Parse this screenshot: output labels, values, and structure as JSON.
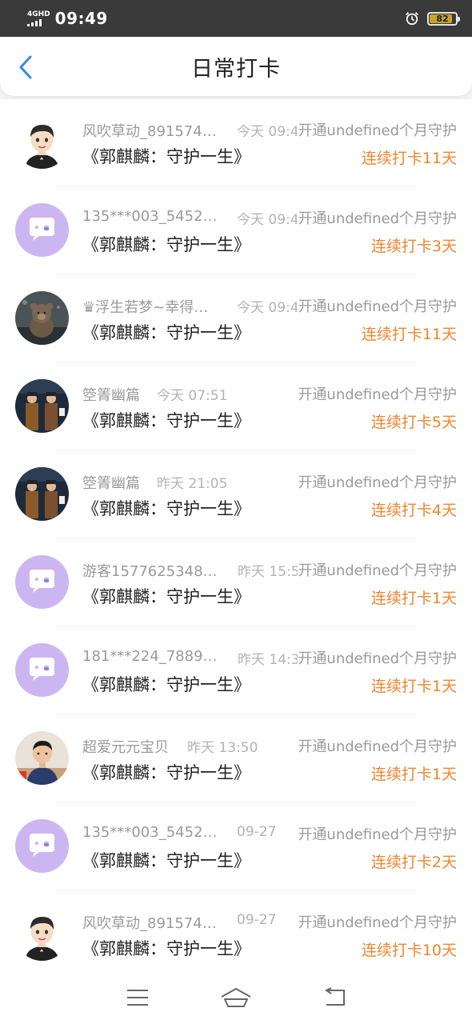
{
  "status_bar": {
    "network": "4GHD",
    "time": "09:49",
    "battery": "82",
    "icons": [
      "signal-icon",
      "alarm-icon",
      "battery-icon"
    ]
  },
  "header": {
    "back_icon": "chevron-left-icon",
    "title": "日常打卡"
  },
  "colors": {
    "accent_blue": "#2f8bf0",
    "streak_orange": "#f0852d",
    "avatar_purple": "#cbb6f2",
    "muted_text": "#9a9a9a"
  },
  "entries": [
    {
      "name": "风吹草动_891574…",
      "time": "今天 09:4…",
      "action": "开通undefined个月守护",
      "book": "《郭麒麟：守护一生》",
      "streak": "连续打卡11天",
      "avatar": "cartoon-boy-avatar"
    },
    {
      "name": "135***003_5452…",
      "time": "今天 09:4…",
      "action": "开通undefined个月守护",
      "book": "《郭麒麟：守护一生》",
      "streak": "连续打卡3天",
      "avatar": "default-chat-avatar"
    },
    {
      "name": "♛浮生若梦~幸得…",
      "time": "今天 09:4…",
      "action": "开通undefined个月守护",
      "book": "《郭麒麟：守护一生》",
      "streak": "连续打卡11天",
      "avatar": "teddy-bear-photo-avatar"
    },
    {
      "name": "箜箐幽篇",
      "time": "今天 07:51",
      "action": "开通undefined个月守护",
      "book": "《郭麒麟：守护一生》",
      "streak": "连续打卡5天",
      "avatar": "two-performers-photo-avatar"
    },
    {
      "name": "箜箐幽篇",
      "time": "昨天 21:05",
      "action": "开通undefined个月守护",
      "book": "《郭麒麟：守护一生》",
      "streak": "连续打卡4天",
      "avatar": "two-performers-photo-avatar"
    },
    {
      "name": "游客1577625348…",
      "time": "昨天 15:5…",
      "action": "开通undefined个月守护",
      "book": "《郭麒麟：守护一生》",
      "streak": "连续打卡1天",
      "avatar": "default-chat-avatar"
    },
    {
      "name": "181***224_7889…",
      "time": "昨天 14:3…",
      "action": "开通undefined个月守护",
      "book": "《郭麒麟：守护一生》",
      "streak": "连续打卡1天",
      "avatar": "default-chat-avatar"
    },
    {
      "name": "超爱元元宝贝",
      "time": "昨天 13:50",
      "action": "开通undefined个月守护",
      "book": "《郭麒麟：守护一生》",
      "streak": "连续打卡1天",
      "avatar": "child-photo-avatar"
    },
    {
      "name": "135***003_5452…",
      "time": "09-27",
      "action": "开通undefined个月守护",
      "book": "《郭麒麟：守护一生》",
      "streak": "连续打卡2天",
      "avatar": "default-chat-avatar"
    },
    {
      "name": "风吹草动_891574…",
      "time": "09-27",
      "action": "开通undefined个月守护",
      "book": "《郭麒麟：守护一生》",
      "streak": "连续打卡10天",
      "avatar": "cartoon-boy-avatar"
    }
  ],
  "nav_bar": {
    "icons": [
      "menu-icon",
      "home-icon",
      "back-icon"
    ]
  }
}
